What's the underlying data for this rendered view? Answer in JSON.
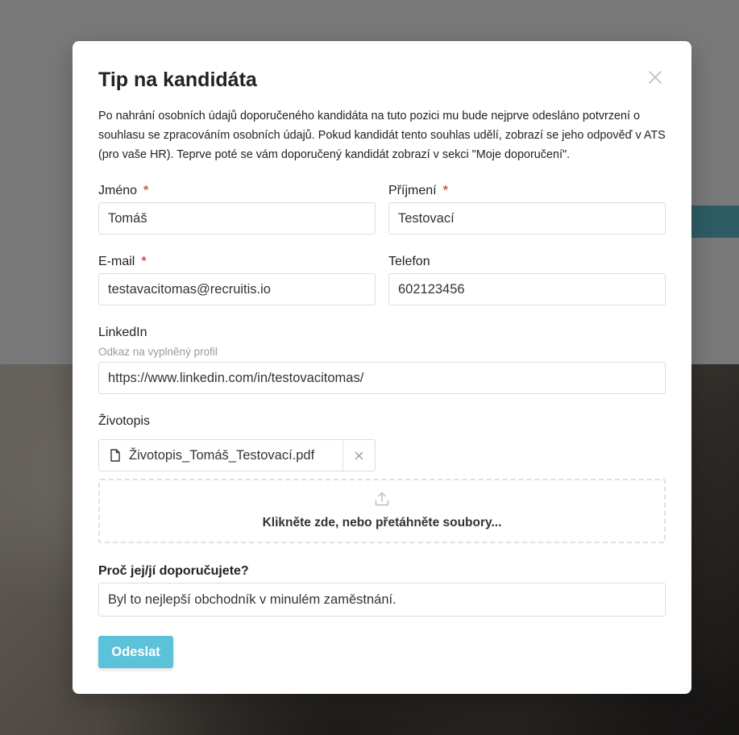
{
  "modal": {
    "title": "Tip na kandidáta",
    "intro": "Po nahrání osobních údajů doporučeného kandidáta na tuto pozici mu bude nejprve odesláno potvrzení o souhlasu se zpracováním osobních údajů. Pokud kandidát tento souhlas udělí, zobrazí se jeho odpověď v ATS (pro vaše HR). Teprve poté se vám doporučený kandidát zobrazí v sekci \"Moje doporučení\".",
    "close_icon": "close-icon"
  },
  "form": {
    "first_name": {
      "label": "Jméno",
      "required_mark": "*",
      "value": "Tomáš"
    },
    "last_name": {
      "label": "Příjmení",
      "required_mark": "*",
      "value": "Testovací"
    },
    "email": {
      "label": "E-mail",
      "required_mark": "*",
      "value": "testavacitomas@recruitis.io"
    },
    "phone": {
      "label": "Telefon",
      "value": "602123456"
    },
    "linkedin": {
      "label": "LinkedIn",
      "hint": "Odkaz na vyplněný profil",
      "value": "https://www.linkedin.com/in/testovacitomas/"
    },
    "cv": {
      "label": "Životopis",
      "file_name": "Životopis_Tomáš_Testovací.pdf",
      "file_icon": "document-icon",
      "remove_icon": "close-icon",
      "upload_icon": "upload-icon",
      "dropzone_text": "Klikněte zde, nebo přetáhněte soubory..."
    },
    "reason": {
      "label": "Proč jej/jí doporučujete?",
      "value": "Byl to nejlepší obchodník v minulém zaměstnání."
    },
    "submit_label": "Odeslat"
  },
  "colors": {
    "accent": "#5cc2d9",
    "required": "#d9534f"
  }
}
